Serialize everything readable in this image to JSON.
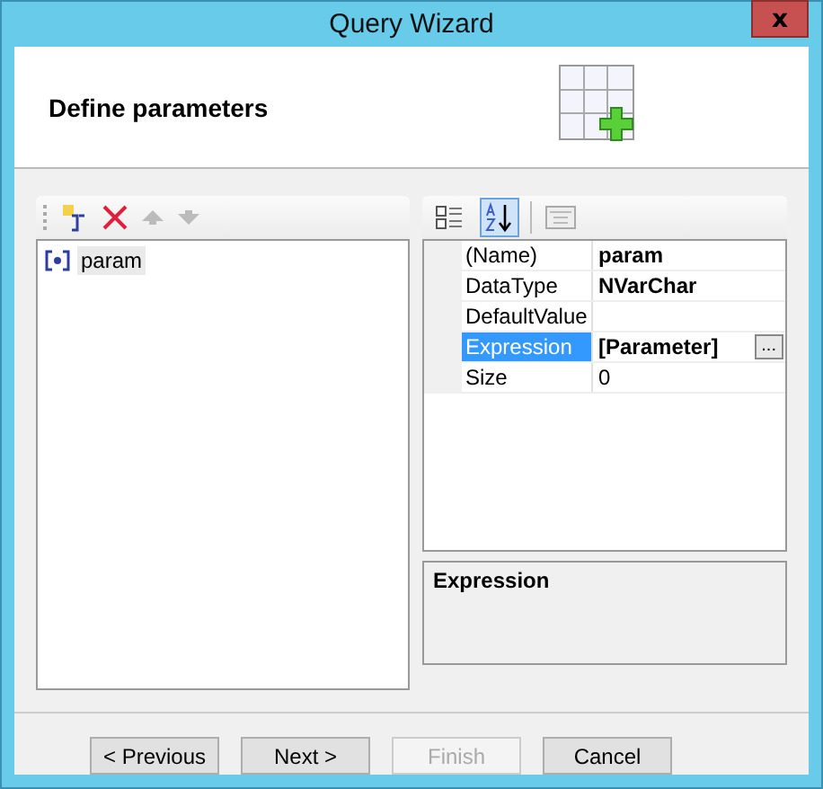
{
  "window": {
    "title": "Query Wizard",
    "close": "x"
  },
  "header": {
    "title": "Define parameters"
  },
  "parameters": {
    "items": [
      {
        "name": "param",
        "selected": true
      }
    ]
  },
  "property_grid": {
    "sort_buttons": [
      {
        "kind": "categorized",
        "selected": false
      },
      {
        "kind": "alphabetical",
        "selected": true
      }
    ],
    "properties": [
      {
        "name": "(Name)",
        "value": "param",
        "bold": true,
        "selected": false
      },
      {
        "name": "DataType",
        "value": "NVarChar",
        "bold": true,
        "selected": false
      },
      {
        "name": "DefaultValue",
        "selected": false
      },
      {
        "name": "Expression",
        "value": "[Parameter]",
        "bold": true,
        "selected": true,
        "button": "..."
      },
      {
        "name": "Size",
        "value": "0",
        "bold": false,
        "selected": false
      }
    ],
    "description": {
      "title": "Expression"
    }
  },
  "buttons": [
    {
      "label": "< Previous",
      "disabled": false
    },
    {
      "label": "Next >",
      "disabled": false
    },
    {
      "label": "Finish",
      "disabled": true
    },
    {
      "label": "Cancel",
      "disabled": false
    }
  ]
}
